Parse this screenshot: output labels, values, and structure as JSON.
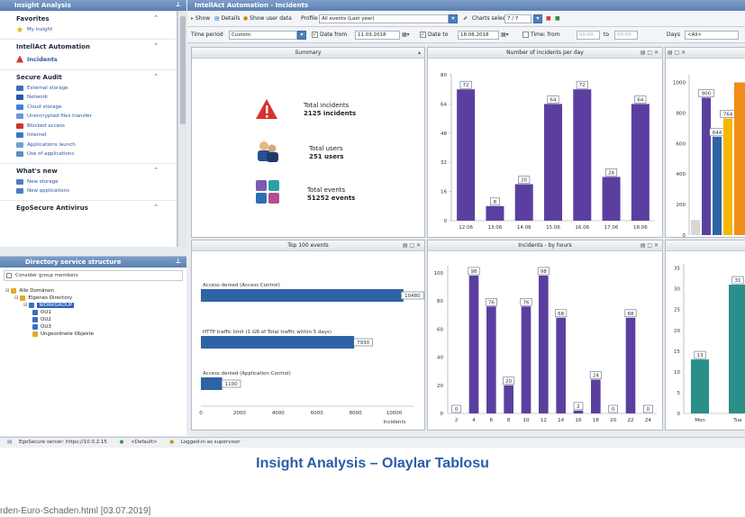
{
  "left_pane": {
    "title": "Insight Analysis",
    "sections": [
      {
        "label": "Favorites",
        "items": [
          {
            "label": "My insight",
            "icon": "star-icon",
            "color": "#e8b21c"
          }
        ]
      },
      {
        "label": "IntellAct Automation",
        "items": [
          {
            "label": "Incidents",
            "icon": "warning-icon",
            "color": "#d8312f",
            "bold": true
          }
        ]
      },
      {
        "label": "Secure Audit",
        "items": [
          {
            "label": "External storage",
            "icon": "drive-icon",
            "color": "#3b6fc2"
          },
          {
            "label": "Network",
            "icon": "network-icon",
            "color": "#2b56a3"
          },
          {
            "label": "Cloud storage",
            "icon": "cloud-icon",
            "color": "#3b82d6"
          },
          {
            "label": "Unencrypted files transfer",
            "icon": "file-icon",
            "color": "#6a9ad6"
          },
          {
            "label": "Blocked access",
            "icon": "lock-icon",
            "color": "#c8372c"
          },
          {
            "label": "Internet",
            "icon": "globe-icon",
            "color": "#2f7ac8"
          },
          {
            "label": "Applications launch",
            "icon": "app-icon",
            "color": "#6fa0d8"
          },
          {
            "label": "Use of applications",
            "icon": "window-icon",
            "color": "#5b8dc9"
          }
        ]
      },
      {
        "label": "What's new",
        "items": [
          {
            "label": "New storage",
            "icon": "storage-icon",
            "color": "#4d7fc4"
          },
          {
            "label": "New applications",
            "icon": "apps-icon",
            "color": "#4d7fc4"
          }
        ]
      },
      {
        "label": "EgoSecure Antivirus",
        "items": []
      }
    ]
  },
  "directory": {
    "title": "Directory service structure",
    "consider_label": "Consider group members",
    "tree": [
      {
        "label": "Alle Domänen",
        "level": 0,
        "color": "#e0a92a"
      },
      {
        "label": "Eigenes Directory",
        "level": 1,
        "color": "#e0a92a"
      },
      {
        "label": "WORKGROUP",
        "level": 2,
        "color": "#3b6fc2",
        "selected": true
      },
      {
        "label": "OU1",
        "level": 3,
        "color": "#3b6fc2"
      },
      {
        "label": "OU2",
        "level": 3,
        "color": "#3b6fc2"
      },
      {
        "label": "OU3",
        "level": 3,
        "color": "#3b6fc2"
      },
      {
        "label": "Ungeordnete Objekte",
        "level": 3,
        "color": "#e0a92a"
      }
    ]
  },
  "status_bar": {
    "server": "EgoSecure server: https://10.0.2.15",
    "profile": "<Default>",
    "user": "Logged-in as supervisor"
  },
  "right_pane": {
    "title": "IntellAct Automation - Incidents",
    "toolbar": {
      "show": "Show",
      "details": "Details",
      "show_user_data": "Show user data",
      "profile_label": "Profile",
      "profile_value": "All events (Last year)",
      "charts_selection": "Charts selection",
      "charts_count": "7 / 7"
    },
    "filters": {
      "time_period_label": "Time period",
      "time_period_value": "Custom",
      "date_from_label": "Date from",
      "date_from_value": "11.03.2018",
      "date_to_label": "Date to",
      "date_to_value": "18.06.2018",
      "time_label": "Time: from",
      "time_from": "00:00",
      "time_to_label": "to",
      "time_to": "00:00",
      "days_label": "Days",
      "days_value": "<All>"
    }
  },
  "summary": {
    "title": "Summary",
    "stats": [
      {
        "label": "Total incidents",
        "value": "2125 incidents",
        "icon": "warning-icon"
      },
      {
        "label": "Total users",
        "value": "251 users",
        "icon": "users-icon"
      },
      {
        "label": "Total events",
        "value": "51252 events",
        "icon": "events-icon"
      }
    ]
  },
  "chart_data": [
    {
      "type": "bar",
      "title": "Number of incidents per day",
      "categories": [
        "12.06",
        "13.06",
        "14.06",
        "15.06",
        "16.06",
        "17.06",
        "18.06"
      ],
      "values": [
        72,
        8,
        20,
        64,
        72,
        24,
        64
      ],
      "ylim": [
        0,
        80
      ],
      "yticks": [
        0,
        16,
        32,
        48,
        64,
        80
      ],
      "color": "#5b3fa0"
    },
    {
      "type": "bar",
      "title": "",
      "values": [
        900,
        644,
        764
      ],
      "ytick_labels": [
        "0",
        "200",
        "400",
        "600",
        "800",
        "1000"
      ],
      "ylim": [
        0,
        1050
      ],
      "bar_labels": [
        "900",
        "644",
        "764"
      ]
    },
    {
      "type": "bar",
      "orientation": "horizontal",
      "title": "Top 100 events",
      "categories": [
        "Access denied (Access Control)",
        "HTTP traffic limit (1 GB of Total traffic within 5 days)",
        "Access denied (Application Control)"
      ],
      "values": [
        10480,
        7930,
        1100
      ],
      "xlim": [
        0,
        11000
      ],
      "xticks": [
        0,
        2000,
        4000,
        6000,
        8000,
        10000
      ],
      "xlabel": "Incidents",
      "color": "#2e64a4"
    },
    {
      "type": "bar",
      "title": "Incidents - by hours",
      "categories": [
        "2",
        "4",
        "6",
        "8",
        "10",
        "12",
        "14",
        "16",
        "18",
        "20",
        "22",
        "24"
      ],
      "values": [
        0,
        98,
        76,
        20,
        76,
        98,
        68,
        2,
        24,
        0,
        68,
        0
      ],
      "ylim": [
        0,
        105
      ],
      "yticks": [
        0,
        20,
        40,
        60,
        80,
        100
      ],
      "color": "#5b3fa0"
    },
    {
      "type": "bar",
      "title": "",
      "categories": [
        "Mon",
        "Tue"
      ],
      "values": [
        13,
        31
      ],
      "ylim": [
        0,
        36
      ],
      "yticks": [
        0,
        5,
        10,
        15,
        20,
        25,
        30,
        35
      ],
      "color": "#2a8f88"
    }
  ],
  "caption": "Insight Analysis – Olaylar Tablosu",
  "cutline": "rden-Euro-Schaden.html  [03.07.2019]"
}
